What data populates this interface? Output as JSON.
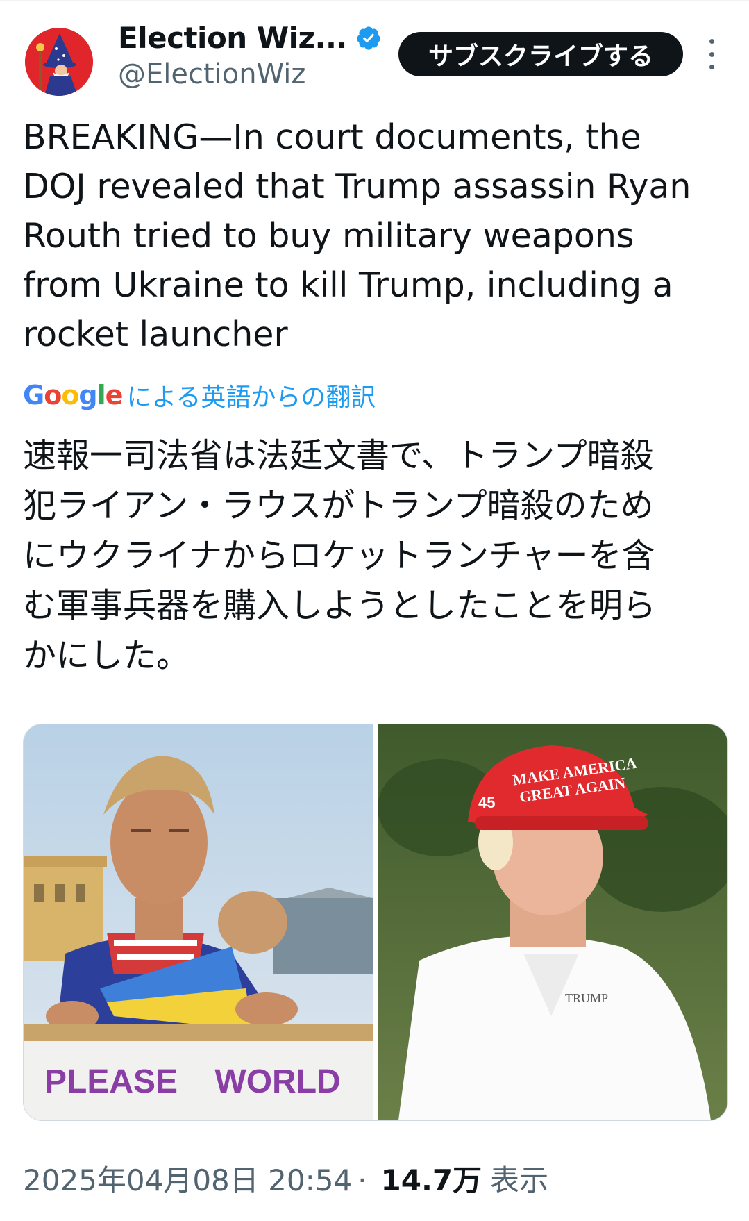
{
  "author": {
    "display_name": "Election Wiz...",
    "handle": "@ElectionWiz",
    "verified": true,
    "avatar_icon": "wizard-avatar-icon"
  },
  "subscribe_label": "サブスクライブする",
  "tweet": {
    "text": "BREAKING—In court documents, the\nDOJ revealed that Trump assassin Ryan\nRouth tried to buy military weapons\nfrom Ukraine to kill Trump, including a\nrocket launcher",
    "translation_source": {
      "google_g": "G",
      "google_o1": "o",
      "google_o2": "o",
      "google_g2": "g",
      "google_l": "l",
      "google_e": "e",
      "label": "による英語からの翻訳"
    },
    "translated_text": "速報一司法省は法廷文書で、トランプ暗殺\n犯ライアン・ラウスがトランプ暗殺のため\nにウクライナからロケットランチャーを含\nむ軍事兵器を購入しようとしたことを明ら\nかにした。"
  },
  "media": {
    "left_sign_text": "PLEASE    WORLD",
    "right_cap_text_1": "MAKE AMERICA",
    "right_cap_text_2": "GREAT AGAIN",
    "right_cap_number": "45",
    "right_shirt_logo": "TRUMP"
  },
  "meta": {
    "timestamp": "2025年04月08日 20:54",
    "separator": "·",
    "views_count": "14.7万",
    "views_label": "表示"
  },
  "colors": {
    "accent": "#1d9bf0",
    "secondary_text": "#536471",
    "subscribe_bg": "#0f1419"
  }
}
